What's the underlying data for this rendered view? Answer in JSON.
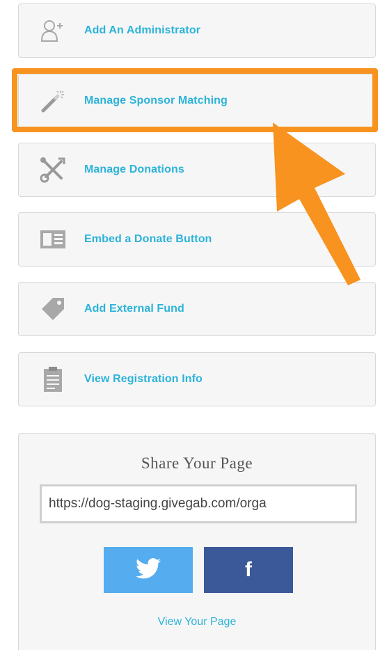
{
  "actions": [
    {
      "label": "Add An Administrator",
      "icon": "add-user-icon"
    },
    {
      "label": "Manage Sponsor Matching",
      "icon": "magic-wand-icon"
    },
    {
      "label": "Manage Donations",
      "icon": "tools-icon"
    },
    {
      "label": "Embed a Donate Button",
      "icon": "embed-icon"
    },
    {
      "label": "Add External Fund",
      "icon": "tag-icon"
    },
    {
      "label": "View Registration Info",
      "icon": "clipboard-icon"
    }
  ],
  "highlighted_action": "Manage Sponsor Matching",
  "share": {
    "title": "Share Your Page",
    "url": "https://dog-staging.givegab.com/orga",
    "twitter_icon": "twitter-icon",
    "facebook_glyph": "f",
    "view_link": "View Your Page"
  },
  "colors": {
    "accent": "#2bb3d9",
    "highlight": "#f7931e",
    "twitter": "#55acee",
    "facebook": "#3b5998"
  }
}
